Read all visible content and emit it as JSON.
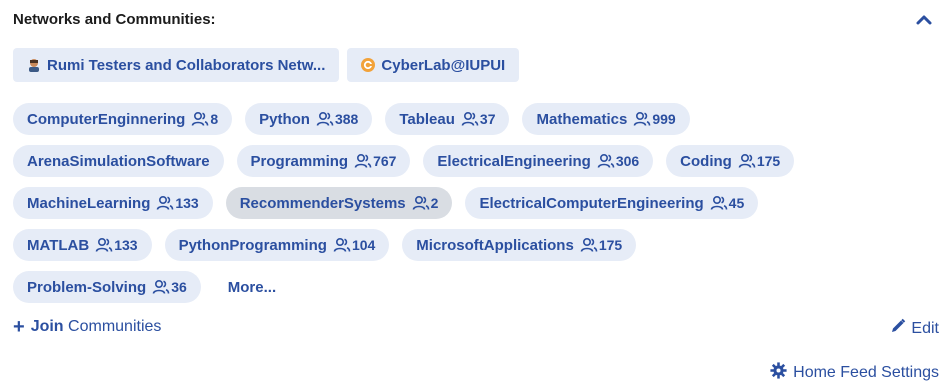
{
  "section": {
    "title": "Networks and Communities:"
  },
  "networks": [
    {
      "label": "Rumi Testers and Collaborators Netw...",
      "icon": "avatar-icon"
    },
    {
      "label": "CyberLab@IUPUI",
      "icon": "cyberlab-logo-icon"
    }
  ],
  "tags": [
    {
      "label": "ComputerEnginnering",
      "count": "8"
    },
    {
      "label": "Python",
      "count": "388"
    },
    {
      "label": "Tableau",
      "count": "37"
    },
    {
      "label": "Mathematics",
      "count": "999"
    },
    {
      "label": "ArenaSimulationSoftware",
      "count": ""
    },
    {
      "label": "Programming",
      "count": "767"
    },
    {
      "label": "ElectricalEngineering",
      "count": "306"
    },
    {
      "label": "Coding",
      "count": "175"
    },
    {
      "label": "MachineLearning",
      "count": "133"
    },
    {
      "label": "RecommenderSystems",
      "count": "2"
    },
    {
      "label": "ElectricalComputerEngineering",
      "count": "45"
    },
    {
      "label": "MATLAB",
      "count": "133"
    },
    {
      "label": "PythonProgramming",
      "count": "104"
    },
    {
      "label": "MicrosoftApplications",
      "count": "175"
    },
    {
      "label": "Problem-Solving",
      "count": "36"
    }
  ],
  "more_label": "More...",
  "footer": {
    "join_bold": "Join",
    "join_rest": "Communities",
    "edit_label": "Edit",
    "settings_label": "Home Feed Settings"
  },
  "colors": {
    "accent": "#2b4fa0",
    "pill_bg": "#e6ecf7",
    "active_pill_bg": "#d9dde3"
  }
}
